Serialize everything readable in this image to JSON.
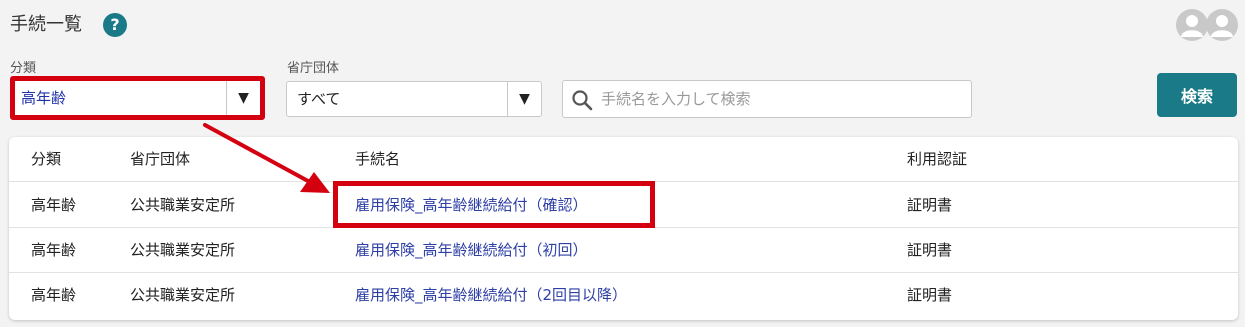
{
  "header": {
    "title": "手続一覧",
    "help_icon": "question-circle-icon",
    "avatar_icon": "user-avatar-icon"
  },
  "filters": {
    "category": {
      "label": "分類",
      "value": "高年齢"
    },
    "agency": {
      "label": "省庁団体",
      "value": "すべて"
    },
    "search": {
      "placeholder": "手続名を入力して検索"
    },
    "search_button": "検索"
  },
  "table": {
    "headers": [
      "分類",
      "省庁団体",
      "手続名",
      "利用認証"
    ],
    "rows": [
      {
        "category": "高年齢",
        "agency": "公共職業安定所",
        "procedure": "雇用保険_高年齢継続給付（確認）",
        "auth": "証明書"
      },
      {
        "category": "高年齢",
        "agency": "公共職業安定所",
        "procedure": "雇用保険_高年齢継続給付（初回）",
        "auth": "証明書"
      },
      {
        "category": "高年齢",
        "agency": "公共職業安定所",
        "procedure": "雇用保険_高年齢継続給付（2回目以降）",
        "auth": "証明書"
      }
    ]
  },
  "colors": {
    "accent": "#1a7a87",
    "highlight": "#d4000f",
    "link": "#2e3fa6"
  }
}
